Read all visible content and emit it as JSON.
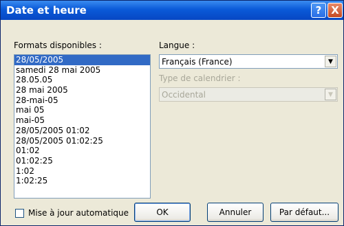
{
  "window": {
    "title": "Date et heure",
    "help_label": "?",
    "close_label": "X"
  },
  "formats": {
    "label": "Formats disponibles :",
    "items": [
      "28/05/2005",
      "samedi 28 mai 2005",
      "28.05.05",
      "28 mai 2005",
      "28-mai-05",
      "mai 05",
      "mai-05",
      "28/05/2005 01:02",
      "28/05/2005 01:02:25",
      "01:02",
      "01:02:25",
      "1:02",
      "1:02:25"
    ],
    "selected_index": 0
  },
  "language": {
    "label": "Langue :",
    "value": "Français (France)"
  },
  "calendar": {
    "label": "Type de calendrier :",
    "value": "Occidental"
  },
  "footer": {
    "auto_update_label": "Mise à jour automatique",
    "auto_update_checked": false,
    "ok_label": "OK",
    "cancel_label": "Annuler",
    "default_label": "Par défaut..."
  },
  "colors": {
    "titlebar": "#0a5ad8",
    "selection": "#316ac5",
    "dialog_bg": "#ece9d8"
  }
}
